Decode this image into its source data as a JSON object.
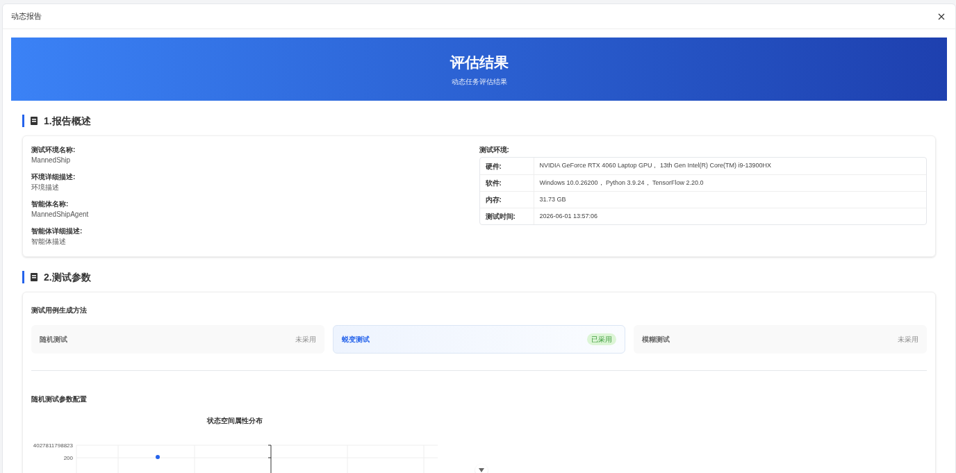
{
  "dialog": {
    "title": "动态报告"
  },
  "banner": {
    "title": "评估结果",
    "subtitle": "动态任务评估结果"
  },
  "overview": {
    "heading": "1.报告概述",
    "fields": [
      {
        "label": "测试环境名称:",
        "value": "MannedShip"
      },
      {
        "label": "环境详细描述:",
        "value": "环境描述"
      },
      {
        "label": "智能体名称:",
        "value": "MannedShipAgent"
      },
      {
        "label": "智能体详细描述:",
        "value": "智能体描述"
      }
    ],
    "env_label": "测试环境:",
    "env_rows": [
      {
        "key": "硬件:",
        "value": "NVIDIA GeForce RTX 4060 Laptop GPU， 13th Gen Intel(R) Core(TM) i9-13900HX"
      },
      {
        "key": "软件:",
        "value": "Windows 10.0.26200， Python 3.9.24， TensorFlow 2.20.0"
      },
      {
        "key": "内存:",
        "value": "31.73 GB"
      },
      {
        "key": "测试时间:",
        "value": "2026-06-01 13:57:06"
      }
    ]
  },
  "params": {
    "heading": "2.测试参数",
    "methods_title": "测试用例生成方法",
    "methods": [
      {
        "name": "随机测试",
        "status": "未采用",
        "selected": false
      },
      {
        "name": "蜕变测试",
        "status": "已采用",
        "selected": true
      },
      {
        "name": "模糊测试",
        "status": "未采用",
        "selected": false
      }
    ],
    "config_title": "随机测试参数配置",
    "chart": {
      "title": "状态空间属性分布",
      "axis_labels": [
        "4027811798823",
        "200"
      ]
    }
  }
}
